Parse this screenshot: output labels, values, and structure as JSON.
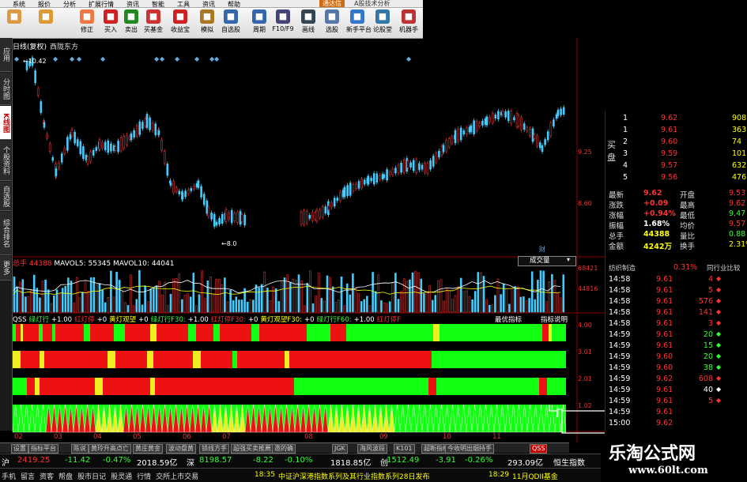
{
  "menu": [
    "系统",
    "报价",
    "分析",
    "扩展行情",
    "资讯",
    "智能",
    "工具",
    "资讯",
    "帮助"
  ],
  "title_brand": "通达信",
  "title_text": "A股技术分析",
  "toolbar": [
    {
      "label": "",
      "icon": "grid-icon",
      "color": "#d94"
    },
    {
      "label": "",
      "icon": "back-arrow-icon",
      "color": "#d93"
    },
    {
      "label": "修正",
      "icon": "revise-icon",
      "color": "#e74"
    },
    {
      "label": "买入",
      "icon": "buy-icon",
      "color": "#c22"
    },
    {
      "label": "卖出",
      "icon": "sell-icon",
      "color": "#282"
    },
    {
      "label": "买基金",
      "icon": "fund-icon",
      "color": "#c33"
    },
    {
      "label": "收益宝",
      "icon": "treasure-icon",
      "color": "#c22"
    },
    {
      "label": "模拟",
      "icon": "hammer-icon",
      "color": "#a72"
    },
    {
      "label": "自选股",
      "icon": "watchlist-icon",
      "color": "#36a"
    },
    {
      "label": "周期",
      "icon": "clock-icon",
      "color": "#36a"
    },
    {
      "label": "F10/F9",
      "icon": "f10-icon",
      "color": "#447"
    },
    {
      "label": "画线",
      "icon": "pen-icon",
      "color": "#345"
    },
    {
      "label": "选股",
      "icon": "filter-icon",
      "color": "#57a"
    },
    {
      "label": "新手平台",
      "icon": "platform-icon",
      "color": "#37c"
    },
    {
      "label": "论股堂",
      "icon": "forum-icon",
      "color": "#37a"
    },
    {
      "label": "机器手",
      "icon": "robot-icon",
      "color": "#b33"
    }
  ],
  "left_tabs": [
    {
      "label": "应用",
      "active": false
    },
    {
      "label": "分时图",
      "active": false
    },
    {
      "label": "K线图",
      "active": true
    },
    {
      "label": "个股资料",
      "active": false
    },
    {
      "label": "自选股",
      "active": false
    },
    {
      "label": "综合排名",
      "active": false
    },
    {
      "label": "更多",
      "active": false
    }
  ],
  "kline": {
    "period": "日线(复权)",
    "stock": "西陇东方",
    "high_label": "10.42",
    "low_label": "8.0",
    "y_ticks": [
      "9.25",
      "8.60"
    ],
    "cai_label": "财"
  },
  "volume": {
    "title": "总手",
    "value": "44388",
    "ma5_label": "MAVOL5:",
    "ma5": "55345",
    "ma10_label": "MAVOL10:",
    "ma10": "44041",
    "y_ticks": [
      "68421",
      "44816"
    ],
    "lot_select": "成交量"
  },
  "qss": {
    "items": [
      {
        "text": "QSS",
        "c": "q-w"
      },
      {
        "text": "绿灯行",
        "c": "q-g"
      },
      {
        "text": "+1.00",
        "c": "q-w"
      },
      {
        "text": "红灯停",
        "c": "q-r"
      },
      {
        "text": "+0",
        "c": "q-w"
      },
      {
        "text": "黄灯观望",
        "c": "q-y"
      },
      {
        "text": "+0",
        "c": "q-w"
      },
      {
        "text": "绿灯行F30:",
        "c": "q-g"
      },
      {
        "text": "+1.00",
        "c": "q-w"
      },
      {
        "text": "红灯停F30:",
        "c": "q-r"
      },
      {
        "text": "+0",
        "c": "q-w"
      },
      {
        "text": "黄灯观望F30:",
        "c": "q-y"
      },
      {
        "text": "+0",
        "c": "q-w"
      },
      {
        "text": "绿灯行F60:",
        "c": "q-g"
      },
      {
        "text": "+1.00",
        "c": "q-w"
      },
      {
        "text": "红灯停F",
        "c": "q-r"
      }
    ],
    "btn_best": "最优指标",
    "btn_explain": "指标说明",
    "y_ticks": [
      "4.00",
      "3.01",
      "2.01",
      "1.02"
    ]
  },
  "x_axis": [
    "02",
    "03",
    "04",
    "05",
    "06",
    "07",
    "08",
    "09",
    "10",
    "11"
  ],
  "bottom_tabs": [
    "设置",
    "指标平台",
    "陈说",
    "黄玲升高点亡",
    "黄庄黄金",
    "波动盘黄",
    "锁线方手",
    "超强买卖推薦",
    "邀的确",
    "JGK",
    "海风波段",
    "K101",
    "超断指标",
    "今收明出烟持手",
    "QSS"
  ],
  "ticker": [
    {
      "t": "沪",
      "c": "#fff"
    },
    {
      "t": "2419.25",
      "c": "#f33"
    },
    {
      "t": "-11.42",
      "c": "#3f3"
    },
    {
      "t": "-0.47%",
      "c": "#3f3"
    },
    {
      "t": "2018.59亿",
      "c": "#fff"
    },
    {
      "t": "深",
      "c": "#fff"
    },
    {
      "t": "8198.57",
      "c": "#3f3"
    },
    {
      "t": "-8.22",
      "c": "#3f3"
    },
    {
      "t": "-0.10%",
      "c": "#3f3"
    },
    {
      "t": "1818.85亿",
      "c": "#fff"
    },
    {
      "t": "创",
      "c": "#fff"
    },
    {
      "t": "1512.49",
      "c": "#3f3"
    },
    {
      "t": "-3.91",
      "c": "#3f3"
    },
    {
      "t": "-0.26%",
      "c": "#3f3"
    },
    {
      "t": "293.09亿",
      "c": "#fff"
    },
    {
      "t": "恒生指数",
      "c": "#fff"
    }
  ],
  "status": {
    "links": [
      "手机",
      "留言",
      "资客",
      "帮盘",
      "股市日记",
      "股灵通",
      "行情",
      "交所上市交易"
    ],
    "news1_time": "18:35",
    "news1": "中证沪深港指数系列及其行业指数系列28日发布",
    "news2_time": "18:29",
    "news2": "11月QDII基金"
  },
  "order_book": {
    "side_label": "买盘",
    "rows": [
      {
        "n": "1",
        "p": "9.62",
        "v": "908"
      },
      {
        "n": "1",
        "p": "9.61",
        "v": "363"
      },
      {
        "n": "2",
        "p": "9.60",
        "v": "74"
      },
      {
        "n": "3",
        "p": "9.59",
        "v": "101"
      },
      {
        "n": "4",
        "p": "9.57",
        "v": "632"
      },
      {
        "n": "5",
        "p": "9.56",
        "v": "476"
      }
    ]
  },
  "quote": [
    {
      "l1": "最新",
      "v1": "9.62",
      "c1": "#f33",
      "l2": "开盘",
      "v2": "9.53",
      "c2": "#f33"
    },
    {
      "l1": "涨跌",
      "v1": "+0.09",
      "c1": "#f33",
      "l2": "最高",
      "v2": "9.62",
      "c2": "#f33"
    },
    {
      "l1": "涨幅",
      "v1": "+0.94%",
      "c1": "#f33",
      "l2": "最低",
      "v2": "9.47",
      "c2": "#3f3"
    },
    {
      "l1": "振幅",
      "v1": "1.68%",
      "c1": "#fff",
      "l2": "均价",
      "v2": "9.57",
      "c2": "#f33"
    },
    {
      "l1": "总手",
      "v1": "44388",
      "c1": "#ff0",
      "l2": "量比",
      "v2": "0.88",
      "c2": "#3f3"
    },
    {
      "l1": "金额",
      "v1": "4242万",
      "c1": "#ff0",
      "l2": "换手",
      "v2": "2.31%",
      "c2": "#ff0"
    }
  ],
  "industry": {
    "name": "纺织制造",
    "pct": "0.31%",
    "link": "同行业比较"
  },
  "trades": [
    {
      "t": "14:58",
      "p": "9.61",
      "v": "4",
      "d": "down"
    },
    {
      "t": "14:58",
      "p": "9.61",
      "v": "5",
      "d": "down"
    },
    {
      "t": "14:58",
      "p": "9.61",
      "v": "576",
      "d": "down"
    },
    {
      "t": "14:58",
      "p": "9.61",
      "v": "141",
      "d": "down"
    },
    {
      "t": "14:58",
      "p": "9.61",
      "v": "3",
      "d": "down"
    },
    {
      "t": "14:59",
      "p": "9.61",
      "v": "20",
      "d": "up"
    },
    {
      "t": "14:59",
      "p": "9.61",
      "v": "15",
      "d": "up"
    },
    {
      "t": "14:59",
      "p": "9.60",
      "v": "20",
      "d": "up"
    },
    {
      "t": "14:59",
      "p": "9.60",
      "v": "38",
      "d": "up"
    },
    {
      "t": "14:59",
      "p": "9.62",
      "v": "608",
      "d": "down"
    },
    {
      "t": "14:59",
      "p": "9.61",
      "v": "40",
      "d": "white"
    },
    {
      "t": "14:59",
      "p": "9.61",
      "v": "5",
      "d": "down"
    },
    {
      "t": "14:59",
      "p": "9.61",
      "v": "",
      "d": ""
    },
    {
      "t": "15:00",
      "p": "9.62",
      "v": "",
      "d": ""
    }
  ],
  "watermark": {
    "cn": "乐淘公式网",
    "url": "www.60lt.com"
  }
}
